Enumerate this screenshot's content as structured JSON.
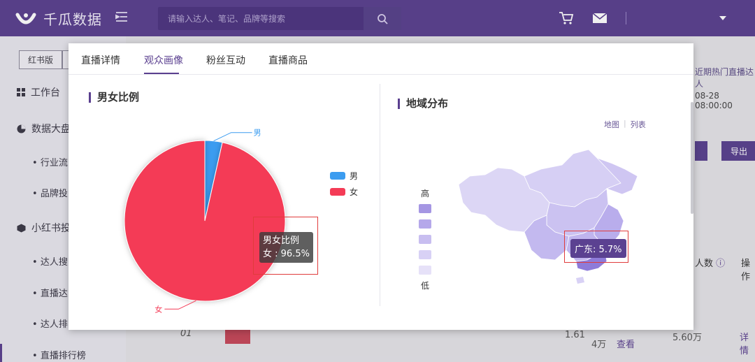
{
  "brand": {
    "name": "千瓜数据"
  },
  "search": {
    "placeholder": "请输入达人、笔记、品牌等搜索"
  },
  "sidebar": {
    "version_tab": "红书版",
    "items": [
      {
        "label": "工作台"
      },
      {
        "label": "数据大盘"
      },
      {
        "label": "行业流"
      },
      {
        "label": "品牌投"
      },
      {
        "label": "小红书投"
      },
      {
        "label": "达人搜"
      },
      {
        "label": "直播达"
      },
      {
        "label": "达人排"
      },
      {
        "label": "直播排行榜"
      }
    ]
  },
  "background": {
    "right_link": "近期热门直播达人",
    "datetime": "08-28 08:00:00",
    "export_label": "导出",
    "column_people": "人数",
    "column_action": "操作",
    "row": {
      "rank": "01",
      "v1": "1.61",
      "v2": "4万",
      "view": "查看",
      "v3": "5.60万",
      "detail": "详情"
    }
  },
  "modal": {
    "tabs": [
      "直播详情",
      "观众画像",
      "粉丝互动",
      "直播商品"
    ],
    "active_tab": "观众画像",
    "gender": {
      "title": "男女比例",
      "legend": [
        {
          "label": "男",
          "color": "#3b9cf0"
        },
        {
          "label": "女",
          "color": "#f43b56"
        }
      ],
      "tooltip_title": "男女比例",
      "tooltip_value": "女 : 96.5%"
    },
    "region": {
      "title": "地域分布",
      "view_map": "地图",
      "view_list": "列表",
      "scale_high": "高",
      "scale_low": "低",
      "tooltip": "广东: 5.7%"
    }
  },
  "chart_data": {
    "type": "pie",
    "title": "男女比例",
    "categories": [
      "男",
      "女"
    ],
    "values": [
      3.5,
      96.5
    ],
    "colors": [
      "#3b9cf0",
      "#f43b56"
    ],
    "legend_position": "right"
  }
}
